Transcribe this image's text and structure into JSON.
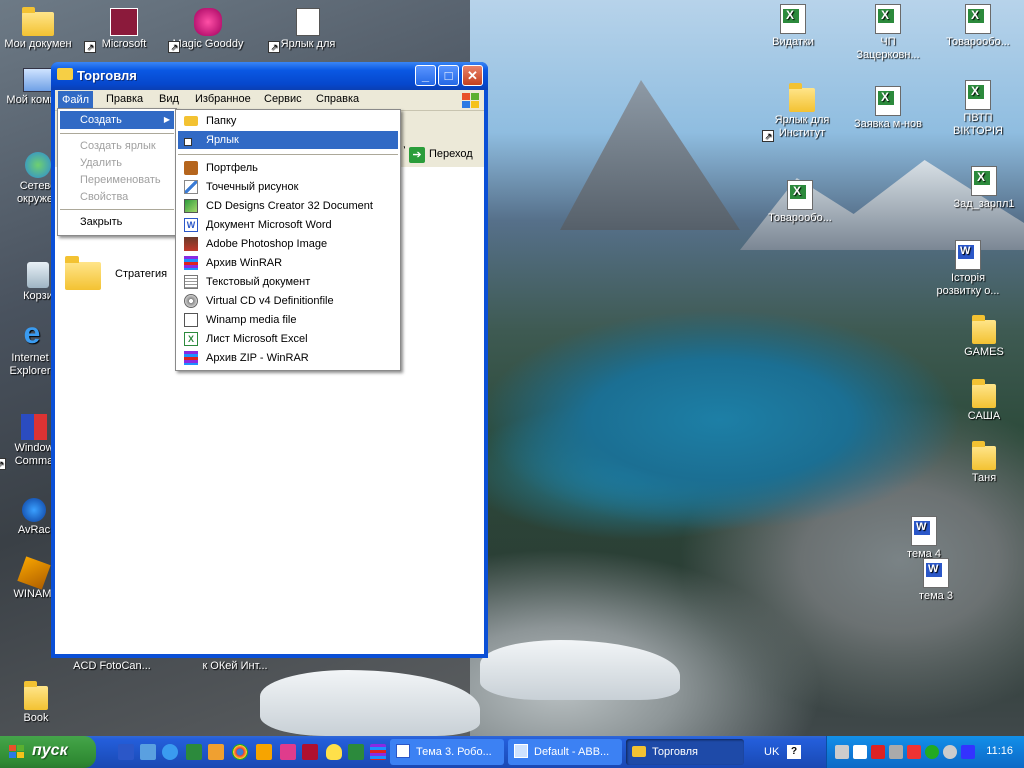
{
  "window": {
    "title": "Торговля",
    "menubar": [
      "Файл",
      "Правка",
      "Вид",
      "Избранное",
      "Сервис",
      "Справка"
    ],
    "address_go_label": "Переход",
    "content_items": [
      {
        "label": "Стратегия",
        "icon": "folder-icon"
      }
    ]
  },
  "file_menu": {
    "items": [
      {
        "label": "Создать",
        "state": "highlighted",
        "has_submenu": true
      },
      {
        "label": "Создать ярлык",
        "state": "disabled"
      },
      {
        "label": "Удалить",
        "state": "disabled"
      },
      {
        "label": "Переименовать",
        "state": "disabled"
      },
      {
        "label": "Свойства",
        "state": "disabled"
      },
      {
        "label": "Закрыть",
        "state": "normal"
      }
    ]
  },
  "new_submenu": {
    "items": [
      {
        "label": "Папку",
        "icon": "folder-icon"
      },
      {
        "label": "Ярлык",
        "icon": "shortcut-icon",
        "state": "highlighted"
      },
      {
        "label": "Портфель",
        "icon": "briefcase-icon"
      },
      {
        "label": "Точечный рисунок",
        "icon": "bitmap-icon"
      },
      {
        "label": "CD Designs Creator 32 Document",
        "icon": "cd-designs-icon"
      },
      {
        "label": "Документ Microsoft Word",
        "icon": "word-doc-icon"
      },
      {
        "label": "Adobe Photoshop Image",
        "icon": "photoshop-icon"
      },
      {
        "label": "Архив WinRAR",
        "icon": "winrar-icon"
      },
      {
        "label": "Текстовый документ",
        "icon": "text-doc-icon"
      },
      {
        "label": "Virtual CD v4 Definitionfile",
        "icon": "virtual-cd-icon"
      },
      {
        "label": "Winamp media file",
        "icon": "winamp-file-icon"
      },
      {
        "label": "Лист Microsoft Excel",
        "icon": "excel-sheet-icon"
      },
      {
        "label": "Архив ZIP - WinRAR",
        "icon": "zip-icon"
      }
    ]
  },
  "desktop_icons_left": [
    {
      "label": "Мои докумен",
      "icon": "my-documents-icon"
    },
    {
      "label": "Мой компью",
      "icon": "my-computer-icon"
    },
    {
      "label": "Сетево окружен",
      "icon": "network-icon"
    },
    {
      "label": "Корзи",
      "icon": "recycle-bin-icon"
    },
    {
      "label": "Internet Explorer",
      "icon": "ie-icon"
    },
    {
      "label": "Window Comma",
      "icon": "windows-commander-icon"
    },
    {
      "label": "AvRac",
      "icon": "avrack-icon"
    },
    {
      "label": "WINAMI",
      "icon": "winamp-icon"
    },
    {
      "label": "Book",
      "icon": "folder-icon"
    }
  ],
  "desktop_icons_top": [
    {
      "label": "Microsoft",
      "icon": "access-icon"
    },
    {
      "label": "Magic Gooddy",
      "icon": "magic-goody-icon"
    },
    {
      "label": "Ярлык для",
      "icon": "shortcut-icon"
    }
  ],
  "desktop_icons_bottom": [
    {
      "label": "ACD FotoCan...",
      "icon": "acd-icon"
    },
    {
      "label": "к ОКей Инт...",
      "icon": "shortcut-icon"
    }
  ],
  "desktop_icons_right": [
    {
      "label": "Видатки",
      "icon": "excel-icon"
    },
    {
      "label": "ЧП Зацерковн...",
      "icon": "excel-icon"
    },
    {
      "label": "Товарообо...",
      "icon": "excel-icon"
    },
    {
      "label": "Ярлык для Институт",
      "icon": "folder-shortcut-icon"
    },
    {
      "label": "Заявка м-нов",
      "icon": "excel-icon"
    },
    {
      "label": "ПВТП ВІКТОРІЯ",
      "icon": "excel-icon"
    },
    {
      "label": "Товарообо...",
      "icon": "excel-icon"
    },
    {
      "label": "Зад_зарпл1",
      "icon": "excel-icon"
    },
    {
      "label": "Історія розвитку о...",
      "icon": "word-icon"
    },
    {
      "label": "GAMES",
      "icon": "folder-icon"
    },
    {
      "label": "САША",
      "icon": "folder-icon"
    },
    {
      "label": "Таня",
      "icon": "folder-icon"
    },
    {
      "label": "тема 4",
      "icon": "word-icon"
    },
    {
      "label": "тема 3",
      "icon": "word-icon"
    }
  ],
  "taskbar": {
    "start_label": "пуск",
    "tasks": [
      {
        "label": "Тема 3. Робо...",
        "icon": "word-icon",
        "active": false
      },
      {
        "label": "Default - ABB...",
        "icon": "abby-icon",
        "active": false
      },
      {
        "label": "Торговля",
        "icon": "folder-icon",
        "active": true
      }
    ],
    "language": "UK",
    "help_glyph": "?",
    "clock": "11:16"
  }
}
